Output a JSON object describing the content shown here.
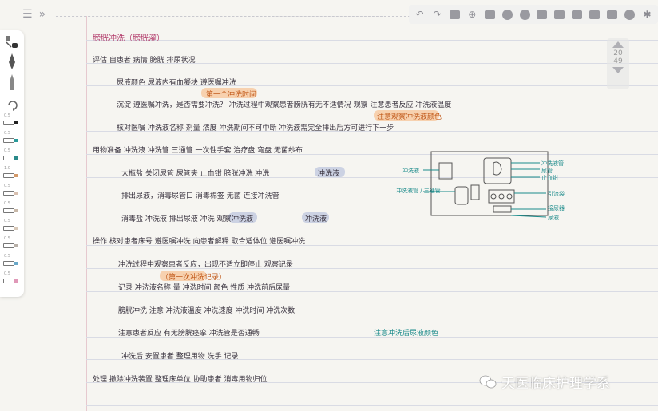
{
  "toolbar": {
    "left_icons": [
      "sidebar-toggle-icon",
      "expand-arrows-icon"
    ],
    "right_icons": [
      "undo-icon",
      "redo-icon",
      "lasso-icon",
      "add-icon",
      "pattern-icon",
      "download-icon",
      "lock-icon",
      "shapes-icon",
      "save-icon",
      "image-icon",
      "export-icon",
      "bookmark-icon",
      "clock-icon",
      "settings-icon"
    ]
  },
  "palette": {
    "tools": [
      "pen-eraser-icon",
      "fountain-pen-icon",
      "brush-icon",
      "refresh-icon"
    ],
    "pens": [
      {
        "size": "0.5",
        "color": "#222222"
      },
      {
        "size": "0.5",
        "color": "#2a9a9a"
      },
      {
        "size": "0.5",
        "color": "#2a8a8a"
      },
      {
        "size": "1.0",
        "color": "#d49a6a"
      },
      {
        "size": "0.5",
        "color": "#d8c0b0"
      },
      {
        "size": "0.5",
        "color": "#c8b8a8"
      },
      {
        "size": "0.5",
        "color": "#d8c8b8"
      },
      {
        "size": "0.5",
        "color": "#b8b0a8"
      },
      {
        "size": "0.5",
        "color": "#6aa8c8"
      },
      {
        "size": "0.5",
        "color": "#e098b8"
      }
    ]
  },
  "pager": {
    "current": "20",
    "total": "49"
  },
  "notes": {
    "title": "膀胱冲洗（膀胱灌）",
    "lines": [
      "评估  自患者  病情  膀胱  排尿状况",
      "尿液颜色  尿液内有血凝块  遵医嘱冲洗",
      "沉淀  遵医嘱冲洗，是否需要冲洗？  冲洗过程中观察患者膀胱有无不适情况  观察  注意患者反应  冲洗液温度",
      "核对医嘱  冲洗液名称  剂量  浓度  冲洗期间不可中断  冲洗液需完全排出后方可进行下一步",
      "用物准备  冲洗液  冲洗管  三通管  一次性手套  治疗盘  弯盘  无菌纱布",
      "大瓶盐  关闭尿管  尿管夹  止血钳  膀胱冲洗  冲洗",
      "排出尿液，消毒尿管口  消毒棉签  无菌  连接冲洗管",
      "消毒盐  冲洗液  排出尿液  冲洗  观察",
      "操作  核对患者床号  遵医嘱冲洗  向患者解释  取合适体位  遵医嘱冲洗",
      "冲洗过程中观察患者反应，出现不适立即停止  观察记录",
      "记录  冲洗液名称  量  冲洗时间  颜色  性质  冲洗前后尿量",
      "膀胱冲洗  注意  冲洗液温度  冲洗速度  冲洗时间  冲洗次数",
      "注意患者反应  有无膀胱痉挛  冲洗管是否通畅",
      "冲洗后  安置患者  整理用物  洗手  记录",
      "处理  撤除冲洗装置  整理床单位  协助患者  消毒用物归位"
    ],
    "highlights": [
      "第一个冲洗时间",
      "注意观察冲洗液颜色",
      "冲洗液",
      "冲洗液",
      "冲洗液",
      "（第一次冲洗记录）"
    ],
    "teal_note": "注意冲洗后尿液颜色"
  },
  "diagram": {
    "left_labels": [
      "冲洗液",
      "冲洗液管 / 三通管"
    ],
    "right_labels": [
      "冲洗液管",
      "尿管",
      "止血钳",
      "引流袋",
      "接尿器",
      "尿液"
    ]
  },
  "watermark": {
    "text": "天医临床护理学系"
  }
}
